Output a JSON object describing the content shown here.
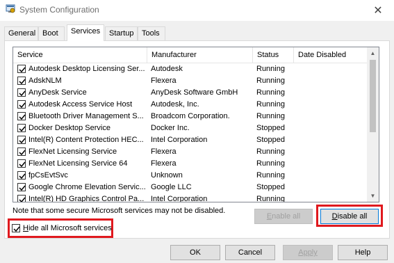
{
  "window": {
    "title": "System Configuration",
    "close_glyph": "✕"
  },
  "tabs": [
    {
      "label": "General",
      "active": false
    },
    {
      "label": "Boot",
      "active": false
    },
    {
      "label": "Services",
      "active": true
    },
    {
      "label": "Startup",
      "active": false
    },
    {
      "label": "Tools",
      "active": false
    }
  ],
  "services_list": {
    "columns": [
      "Service",
      "Manufacturer",
      "Status",
      "Date Disabled"
    ],
    "rows": [
      {
        "checked": true,
        "service": "Autodesk Desktop Licensing Ser...",
        "manufacturer": "Autodesk",
        "status": "Running",
        "date_disabled": ""
      },
      {
        "checked": true,
        "service": "AdskNLM",
        "manufacturer": "Flexera",
        "status": "Running",
        "date_disabled": ""
      },
      {
        "checked": true,
        "service": "AnyDesk Service",
        "manufacturer": "AnyDesk Software GmbH",
        "status": "Running",
        "date_disabled": ""
      },
      {
        "checked": true,
        "service": "Autodesk Access Service Host",
        "manufacturer": "Autodesk, Inc.",
        "status": "Running",
        "date_disabled": ""
      },
      {
        "checked": true,
        "service": "Bluetooth Driver Management S...",
        "manufacturer": "Broadcom Corporation.",
        "status": "Running",
        "date_disabled": ""
      },
      {
        "checked": true,
        "service": "Docker Desktop Service",
        "manufacturer": "Docker Inc.",
        "status": "Stopped",
        "date_disabled": ""
      },
      {
        "checked": true,
        "service": "Intel(R) Content Protection HEC...",
        "manufacturer": "Intel Corporation",
        "status": "Stopped",
        "date_disabled": ""
      },
      {
        "checked": true,
        "service": "FlexNet Licensing Service",
        "manufacturer": "Flexera",
        "status": "Running",
        "date_disabled": ""
      },
      {
        "checked": true,
        "service": "FlexNet Licensing Service 64",
        "manufacturer": "Flexera",
        "status": "Running",
        "date_disabled": ""
      },
      {
        "checked": true,
        "service": "fpCsEvtSvc",
        "manufacturer": "Unknown",
        "status": "Running",
        "date_disabled": ""
      },
      {
        "checked": true,
        "service": "Google Chrome Elevation Servic...",
        "manufacturer": "Google LLC",
        "status": "Stopped",
        "date_disabled": ""
      },
      {
        "checked": true,
        "service": "Intel(R) HD Graphics Control Pa...",
        "manufacturer": "Intel Corporation",
        "status": "Running",
        "date_disabled": ""
      }
    ]
  },
  "note": "Note that some secure Microsoft services may not be disabled.",
  "buttons": {
    "enable_all": {
      "pre": "",
      "accel": "E",
      "post": "nable all",
      "enabled": false
    },
    "disable_all": {
      "pre": "",
      "accel": "D",
      "post": "isable all",
      "enabled": true
    },
    "ok": "OK",
    "cancel": "Cancel",
    "apply": "Apply",
    "help": "Help"
  },
  "hide_ms": {
    "checked": true,
    "pre": "",
    "accel": "H",
    "post": "ide all Microsoft services"
  },
  "colors": {
    "highlight": "#e0191e",
    "focus_border": "#0078d7"
  }
}
